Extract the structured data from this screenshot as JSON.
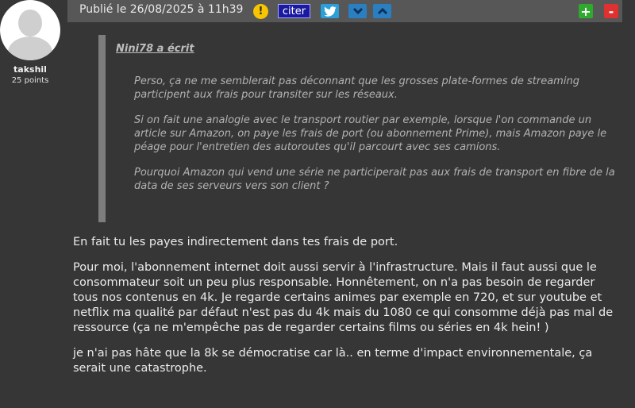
{
  "author": {
    "name": "takshil",
    "points": "25 points"
  },
  "header": {
    "date": "Publié le 26/08/2025 à 11h39",
    "warn_symbol": "!",
    "quote_label": "citer",
    "plus_symbol": "+",
    "minus_symbol": "-"
  },
  "quote": {
    "author": "Nini78 a écrit",
    "paragraphs": [
      "Perso, ça ne me semblerait pas déconnant que les grosses plate-formes de streaming participent aux frais pour transiter sur les réseaux.",
      "Si on fait une analogie avec le transport routier par exemple, lorsque l'on commande un article sur Amazon, on paye les frais de port (ou abonnement Prime), mais Amazon paye le péage pour l'entretien des autoroutes qu'il parcourt avec ses camions.",
      "Pourquoi Amazon qui vend une série ne participerait pas aux frais de transport en fibre de la data de ses serveurs vers son client ?"
    ]
  },
  "reply": {
    "paragraphs": [
      "En fait tu les payes indirectement dans tes frais de port.",
      "Pour moi, l'abonnement internet doit aussi servir à l'infrastructure. Mais il faut aussi que le consommateur soit un peu plus responsable. Honnêtement, on n'a pas besoin de regarder tous nos contenus en 4k. Je regarde certains animes par exemple en 720, et sur youtube et netflix ma qualité par défaut n'est pas du 4k mais du 1080 ce qui consomme déjà pas mal de ressource (ça ne m'empêche pas de regarder certains films ou séries en 4k hein! )",
      "je n'ai pas hâte que la 8k se démocratise car là.. en terme d'impact environnementale, ça serait une catastrophe."
    ]
  }
}
